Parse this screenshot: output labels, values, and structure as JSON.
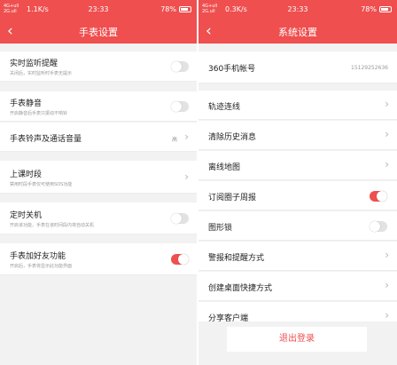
{
  "colors": {
    "accent": "#ef4f4f",
    "background": "#f2f2f2",
    "toggle_off": "#e2e2e2"
  },
  "left": {
    "status": {
      "network_top": "4G+ull",
      "network_bottom": "2G.ull",
      "speed": "1.1K/s",
      "time": "23:33",
      "battery": "78%"
    },
    "nav": {
      "back_icon": "chevron-left-icon",
      "title": "手表设置"
    },
    "rows": [
      {
        "label": "实时监听提醒",
        "sub": "关闭后，实时监听时手表无提示",
        "toggle": "off"
      },
      {
        "label": "手表静音",
        "sub": "开启静音后手表只振动不响铃",
        "toggle": "off"
      },
      {
        "label": "手表铃声及通话音量",
        "value": "高"
      },
      {
        "label": "上课时段",
        "sub": "禁用时段手表仅可使用SOS功能"
      },
      {
        "label": "定时关机",
        "sub": "开启该功能，手表在该时间段内将自动关机",
        "toggle": "off"
      },
      {
        "label": "手表加好友功能",
        "sub": "开启后，手表将显示此功能界面",
        "toggle": "on"
      }
    ]
  },
  "right": {
    "status": {
      "network_top": "4G+ull",
      "network_bottom": "2G.ull",
      "speed": "0.3K/s",
      "time": "23:33",
      "battery": "78%"
    },
    "nav": {
      "back_icon": "chevron-left-icon",
      "title": "系统设置"
    },
    "account": {
      "label": "360手机帐号",
      "value": "15129252636"
    },
    "rows": [
      {
        "label": "轨迹连线"
      },
      {
        "label": "清除历史消息"
      },
      {
        "label": "离线地图"
      },
      {
        "label": "订阅圈子周报",
        "toggle": "on"
      },
      {
        "label": "图形锁",
        "toggle": "off"
      },
      {
        "label": "警报和提醒方式"
      },
      {
        "label": "创建桌面快捷方式"
      },
      {
        "label": "分享客户端"
      }
    ],
    "logout_label": "退出登录"
  }
}
